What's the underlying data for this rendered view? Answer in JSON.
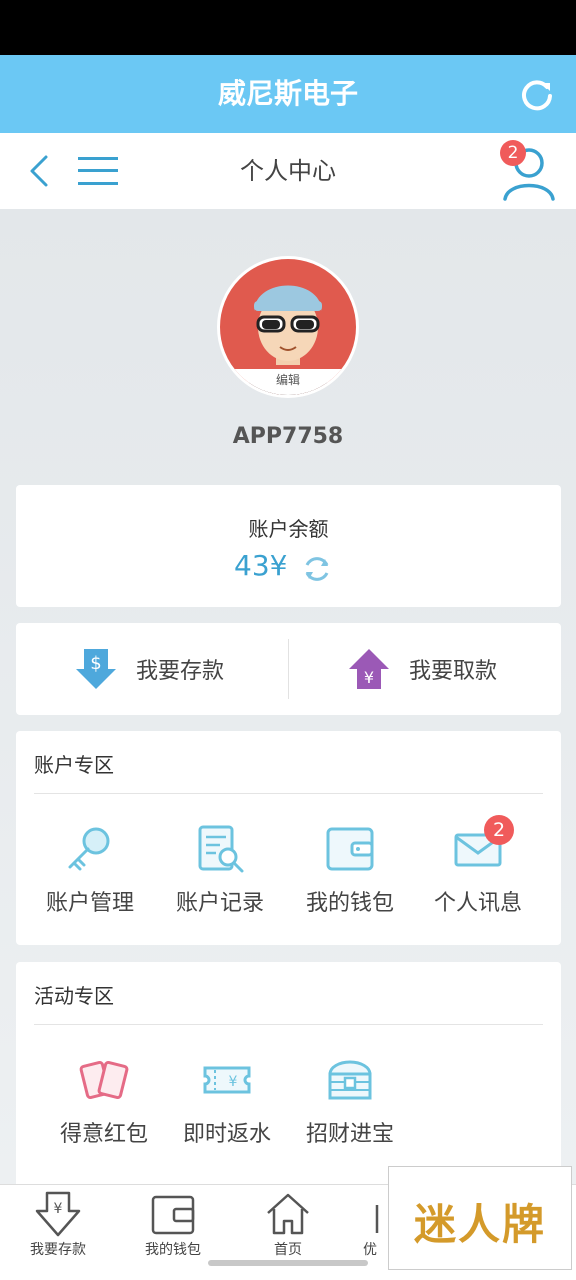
{
  "app": {
    "title": "威尼斯电子"
  },
  "nav": {
    "title": "个人中心",
    "badge": "2"
  },
  "profile": {
    "avatar_edit": "编辑",
    "username": "APP7758"
  },
  "balance": {
    "label": "账户余额",
    "value": "43¥"
  },
  "actions": {
    "deposit": "我要存款",
    "withdraw": "我要取款"
  },
  "account_section": {
    "title": "账户专区",
    "items": [
      {
        "label": "账户管理",
        "icon": "key-icon"
      },
      {
        "label": "账户记录",
        "icon": "record-search-icon"
      },
      {
        "label": "我的钱包",
        "icon": "wallet-icon"
      },
      {
        "label": "个人讯息",
        "icon": "mail-icon",
        "badge": "2"
      }
    ]
  },
  "activity_section": {
    "title": "活动专区",
    "items": [
      {
        "label": "得意红包",
        "icon": "red-envelope-icon"
      },
      {
        "label": "即时返水",
        "icon": "ticket-yen-icon"
      },
      {
        "label": "招财进宝",
        "icon": "treasure-chest-icon"
      }
    ]
  },
  "tabbar": {
    "items": [
      {
        "label": "我要存款",
        "icon": "deposit-icon"
      },
      {
        "label": "我的钱包",
        "icon": "wallet-icon"
      },
      {
        "label": "首页",
        "icon": "home-icon"
      },
      {
        "label": "优",
        "icon": "gift-icon"
      }
    ]
  },
  "watermark": {
    "text": "迷人牌"
  },
  "colors": {
    "appbar": "#6bc8f4",
    "accent": "#3aa1d0",
    "badge": "#f05b5b"
  }
}
